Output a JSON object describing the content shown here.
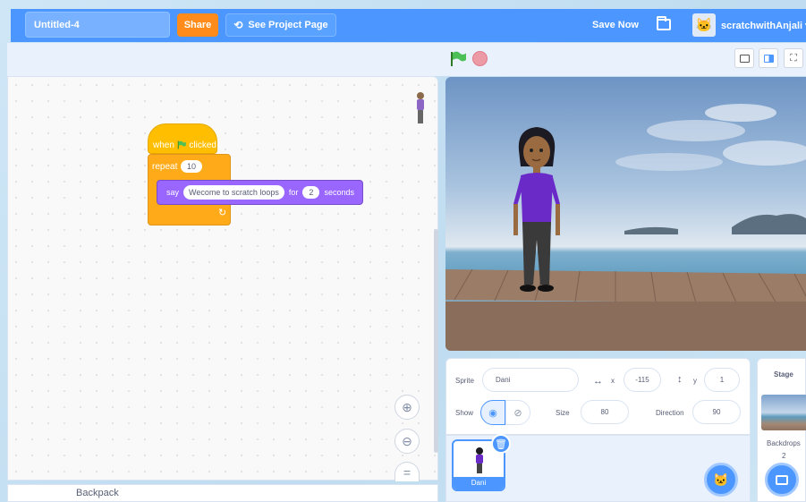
{
  "menubar": {
    "project_title": "Untitled-4",
    "share_label": "Share",
    "see_project_label": "See Project Page",
    "save_now_label": "Save Now",
    "username": "scratchwithAnjali"
  },
  "code": {
    "hat_when": "when",
    "hat_clicked": "clicked",
    "repeat_label": "repeat",
    "repeat_count": "10",
    "say_label": "say",
    "say_text": "Wecome to scratch loops",
    "say_for": "for",
    "say_seconds_value": "2",
    "say_seconds_label": "seconds"
  },
  "backpack": {
    "label": "Backpack"
  },
  "sprite_info": {
    "sprite_label": "Sprite",
    "sprite_name": "Dani",
    "x_label": "x",
    "x_value": "-115",
    "y_label": "y",
    "y_value": "1",
    "show_label": "Show",
    "size_label": "Size",
    "size_value": "80",
    "direction_label": "Direction",
    "direction_value": "90"
  },
  "sprite_list": {
    "items": [
      {
        "name": "Dani"
      }
    ]
  },
  "stage_panel": {
    "title": "Stage",
    "backdrops_label": "Backdrops",
    "backdrops_count": "2"
  },
  "colors": {
    "menubar": "#4c97ff",
    "share": "#ff8c1a",
    "events_block": "#ffbf00",
    "control_block": "#ffab19",
    "looks_block": "#9966ff"
  }
}
